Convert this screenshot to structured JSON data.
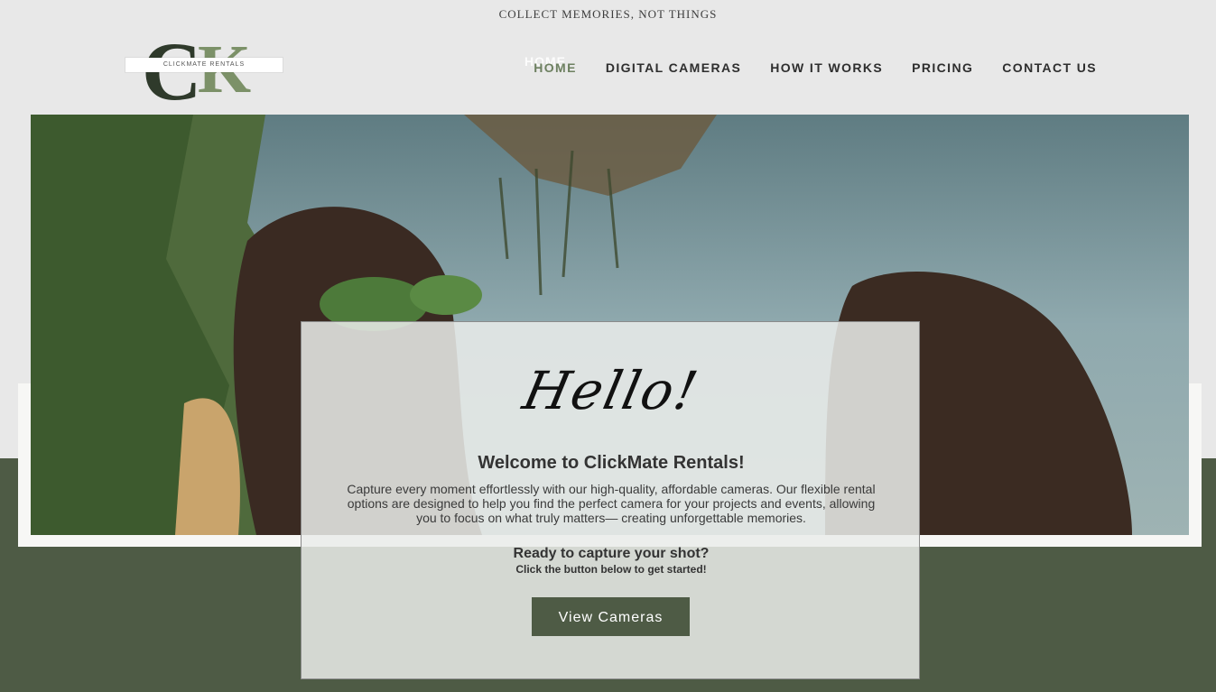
{
  "tagline": "COLLECT MEMORIES, NOT THINGS",
  "logo": {
    "letters": "CK",
    "text": "CLICKMATE RENTALS"
  },
  "nav": {
    "ghost_home": "HOME",
    "items": [
      {
        "label": "HOME"
      },
      {
        "label": "DIGITAL CAMERAS"
      },
      {
        "label": "HOW IT WORKS"
      },
      {
        "label": "PRICING"
      },
      {
        "label": "CONTACT US"
      }
    ]
  },
  "hero_card": {
    "script_greeting": "Hello!",
    "heading": "Welcome to ClickMate Rentals!",
    "description": "Capture every moment effortlessly with our high-quality, affordable cameras. Our flexible rental options are designed to help you find the perfect camera for your projects and events, allowing you to focus on what truly matters— creating unforgettable memories.",
    "cta_heading": "Ready to capture your shot?",
    "cta_subtext": "Click the button below to get started!",
    "button_label": "View Cameras"
  },
  "colors": {
    "brand_green": "#4e5b45",
    "nav_active": "#6d8060",
    "page_bg": "#e8e8e8"
  }
}
